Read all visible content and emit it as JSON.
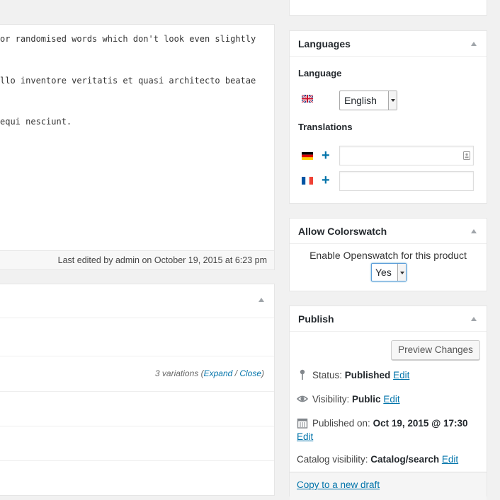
{
  "editor": {
    "lines": [
      "or randomised words which don't look even slightly",
      "llo inventore veritatis et quasi architecto beatae",
      "equi nesciunt."
    ],
    "last_edited": "Last edited by admin on October 19, 2015 at 6:23 pm"
  },
  "variations": {
    "count_text": "3 variations (",
    "expand": "Expand",
    "sep": " / ",
    "close": "Close",
    "end": ")"
  },
  "languages": {
    "title": "Languages",
    "language_label": "Language",
    "selected_language": "English",
    "translations_label": "Translations",
    "translations": [
      {
        "flag": "german-flag-icon",
        "value": ""
      },
      {
        "flag": "french-flag-icon",
        "value": ""
      }
    ]
  },
  "colorswatch": {
    "title": "Allow Colorswatch",
    "label": "Enable Openswatch for this product",
    "selected": "Yes"
  },
  "publish": {
    "title": "Publish",
    "preview_button": "Preview Changes",
    "status_label": "Status: ",
    "status_value": "Published",
    "visibility_label": "Visibility: ",
    "visibility_value": "Public",
    "published_label": "Published on: ",
    "published_value": "Oct 19, 2015 @ 17:30",
    "catalog_label": "Catalog visibility: ",
    "catalog_value": "Catalog/search",
    "edit": "Edit",
    "copy_link": "Copy to a new draft"
  },
  "colors": {
    "link": "#0073aa",
    "background": "#f1f1f1"
  }
}
